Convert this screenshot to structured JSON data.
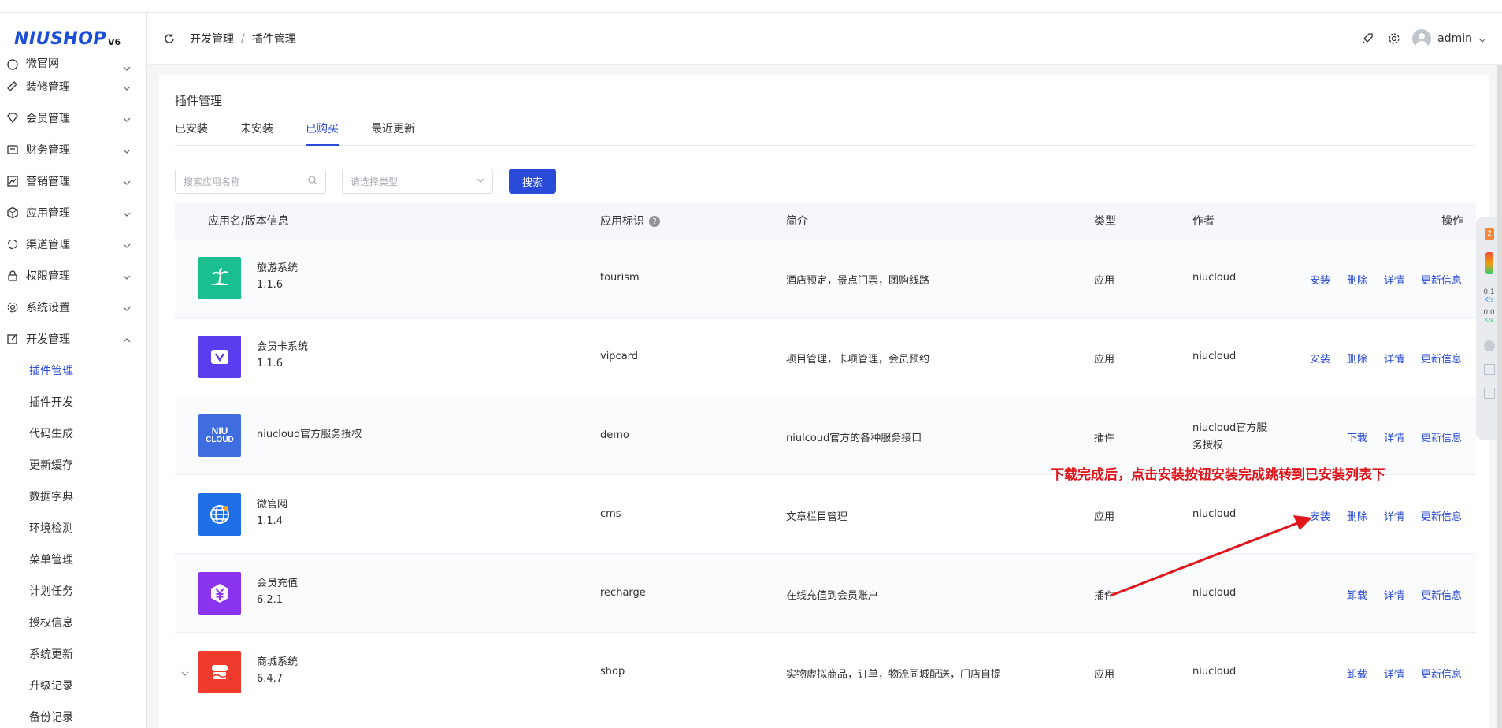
{
  "header": {
    "breadcrumb": [
      "开发管理",
      "插件管理"
    ],
    "username": "admin"
  },
  "logo": {
    "text": "NIUSHOP",
    "version": "V6"
  },
  "sidebar": {
    "partial_item": "微官网",
    "items": [
      {
        "label": "装修管理",
        "icon": "brush-icon"
      },
      {
        "label": "会员管理",
        "icon": "diamond-icon"
      },
      {
        "label": "财务管理",
        "icon": "wallet-icon"
      },
      {
        "label": "营销管理",
        "icon": "chart-icon"
      },
      {
        "label": "应用管理",
        "icon": "cube-icon"
      },
      {
        "label": "渠道管理",
        "icon": "cycle-icon"
      },
      {
        "label": "权限管理",
        "icon": "lock-icon"
      },
      {
        "label": "系统设置",
        "icon": "gear-icon"
      },
      {
        "label": "开发管理",
        "icon": "edit-icon"
      }
    ],
    "sub_items": [
      "插件管理",
      "插件开发",
      "代码生成",
      "更新缓存",
      "数据字典",
      "环境检测",
      "菜单管理",
      "计划任务",
      "授权信息",
      "系统更新",
      "升级记录",
      "备份记录"
    ]
  },
  "card": {
    "title": "插件管理",
    "tabs": [
      "已安装",
      "未安装",
      "已购买",
      "最近更新"
    ],
    "active_tab": "已购买"
  },
  "filters": {
    "search_placeholder": "搜索应用名称",
    "type_placeholder": "请选择类型",
    "search_button": "搜索"
  },
  "table": {
    "headers": {
      "name": "应用名/版本信息",
      "key": "应用标识",
      "desc": "简介",
      "type": "类型",
      "author": "作者",
      "ops": "操作"
    },
    "rows": [
      {
        "name": "旅游系统",
        "version": "1.1.6",
        "key": "tourism",
        "desc": "酒店预定，景点门票，团购线路",
        "type": "应用",
        "author": "niucloud",
        "ops": [
          "安装",
          "删除",
          "详情",
          "更新信息"
        ],
        "icon_color": "#1bbf8f",
        "icon": "island-icon"
      },
      {
        "name": "会员卡系统",
        "version": "1.1.6",
        "key": "vipcard",
        "desc": "项目管理，卡项管理，会员预约",
        "type": "应用",
        "author": "niucloud",
        "ops": [
          "安装",
          "删除",
          "详情",
          "更新信息"
        ],
        "icon_color": "#5b3df0",
        "icon": "vipcard-icon"
      },
      {
        "name": "niucloud官方服务授权",
        "version": "",
        "key": "demo",
        "desc": "niulcoud官方的各种服务接口",
        "type": "插件",
        "author": "niucloud官方服务授权",
        "ops": [
          "下载",
          "详情",
          "更新信息"
        ],
        "icon_color": "#3f6de0",
        "icon": "niucloud-icon",
        "icon_text_1": "NIU",
        "icon_text_2": "CLOUD"
      },
      {
        "name": "微官网",
        "version": "1.1.4",
        "key": "cms",
        "desc": "文章栏目管理",
        "type": "应用",
        "author": "niucloud",
        "ops": [
          "安装",
          "删除",
          "详情",
          "更新信息"
        ],
        "icon_color": "#1f6fe8",
        "icon": "globe-icon"
      },
      {
        "name": "会员充值",
        "version": "6.2.1",
        "key": "recharge",
        "desc": "在线充值到会员账户",
        "type": "插件",
        "author": "niucloud",
        "ops": [
          "卸载",
          "详情",
          "更新信息"
        ],
        "icon_color": "#8a34f0",
        "icon": "yuan-icon"
      },
      {
        "name": "商城系统",
        "version": "6.4.7",
        "key": "shop",
        "desc": "实物虚拟商品，订单，物流同城配送，门店自提",
        "type": "应用",
        "author": "niucloud",
        "ops": [
          "卸载",
          "详情",
          "更新信息"
        ],
        "icon_color": "#ef3b2d",
        "icon": "shop-icon"
      }
    ]
  },
  "annotation": "下载完成后，点击安装按钮安装完成跳转到已安装列表下",
  "colors": {
    "accent": "#2a4bd7",
    "annotation": "#e0151b"
  },
  "float_widget": {
    "up_speed": "0.1",
    "down_speed": "0.0",
    "unit": "K/s",
    "badge": "2"
  }
}
